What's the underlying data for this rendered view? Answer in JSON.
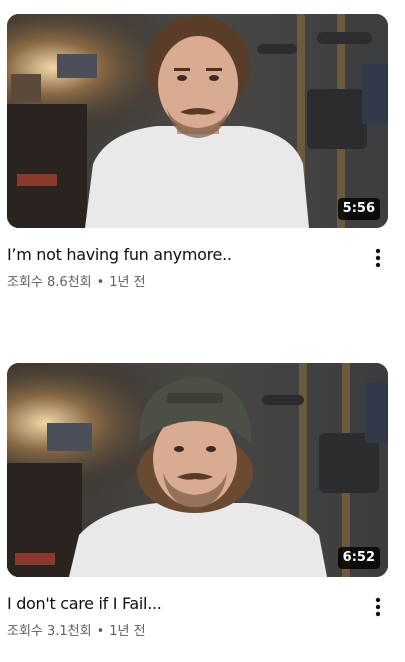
{
  "videos": [
    {
      "duration": "5:56",
      "title": "I’m not having fun anymore..",
      "views": "조회수 8.6천회",
      "separator": "•",
      "age": "1년 전",
      "menu_icon": "more-vert-icon"
    },
    {
      "duration": "6:52",
      "title": "I don't care if I Fail...",
      "views": "조회수 3.1천회",
      "separator": "•",
      "age": "1년 전",
      "menu_icon": "more-vert-icon"
    }
  ]
}
